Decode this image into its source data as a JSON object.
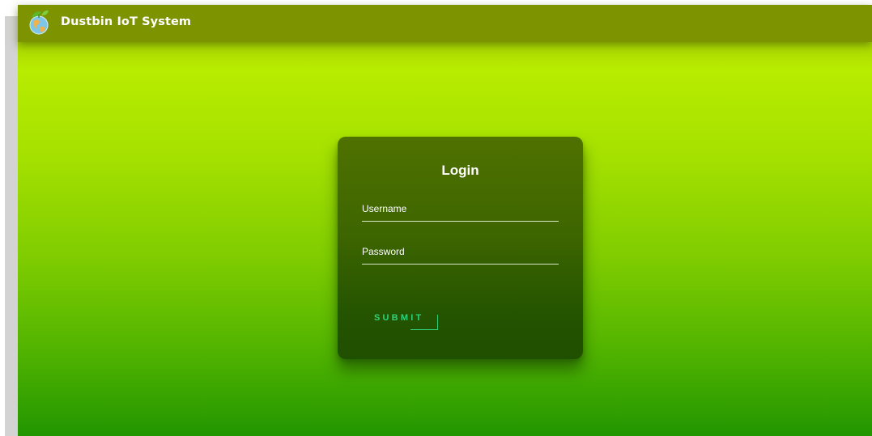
{
  "header": {
    "brand": "Dustbin IoT System",
    "logo_icon": "earth-leaf-icon"
  },
  "login": {
    "title": "Login",
    "username_label": "Username",
    "password_label": "Password",
    "submit_label": "SUBMIT"
  },
  "colors": {
    "header_bg": "#7d9400",
    "card_bg": "#3d6500",
    "submit_accent": "#2fd07a",
    "page_gradient_top": "#b8ec00",
    "page_gradient_bottom": "#229600"
  }
}
